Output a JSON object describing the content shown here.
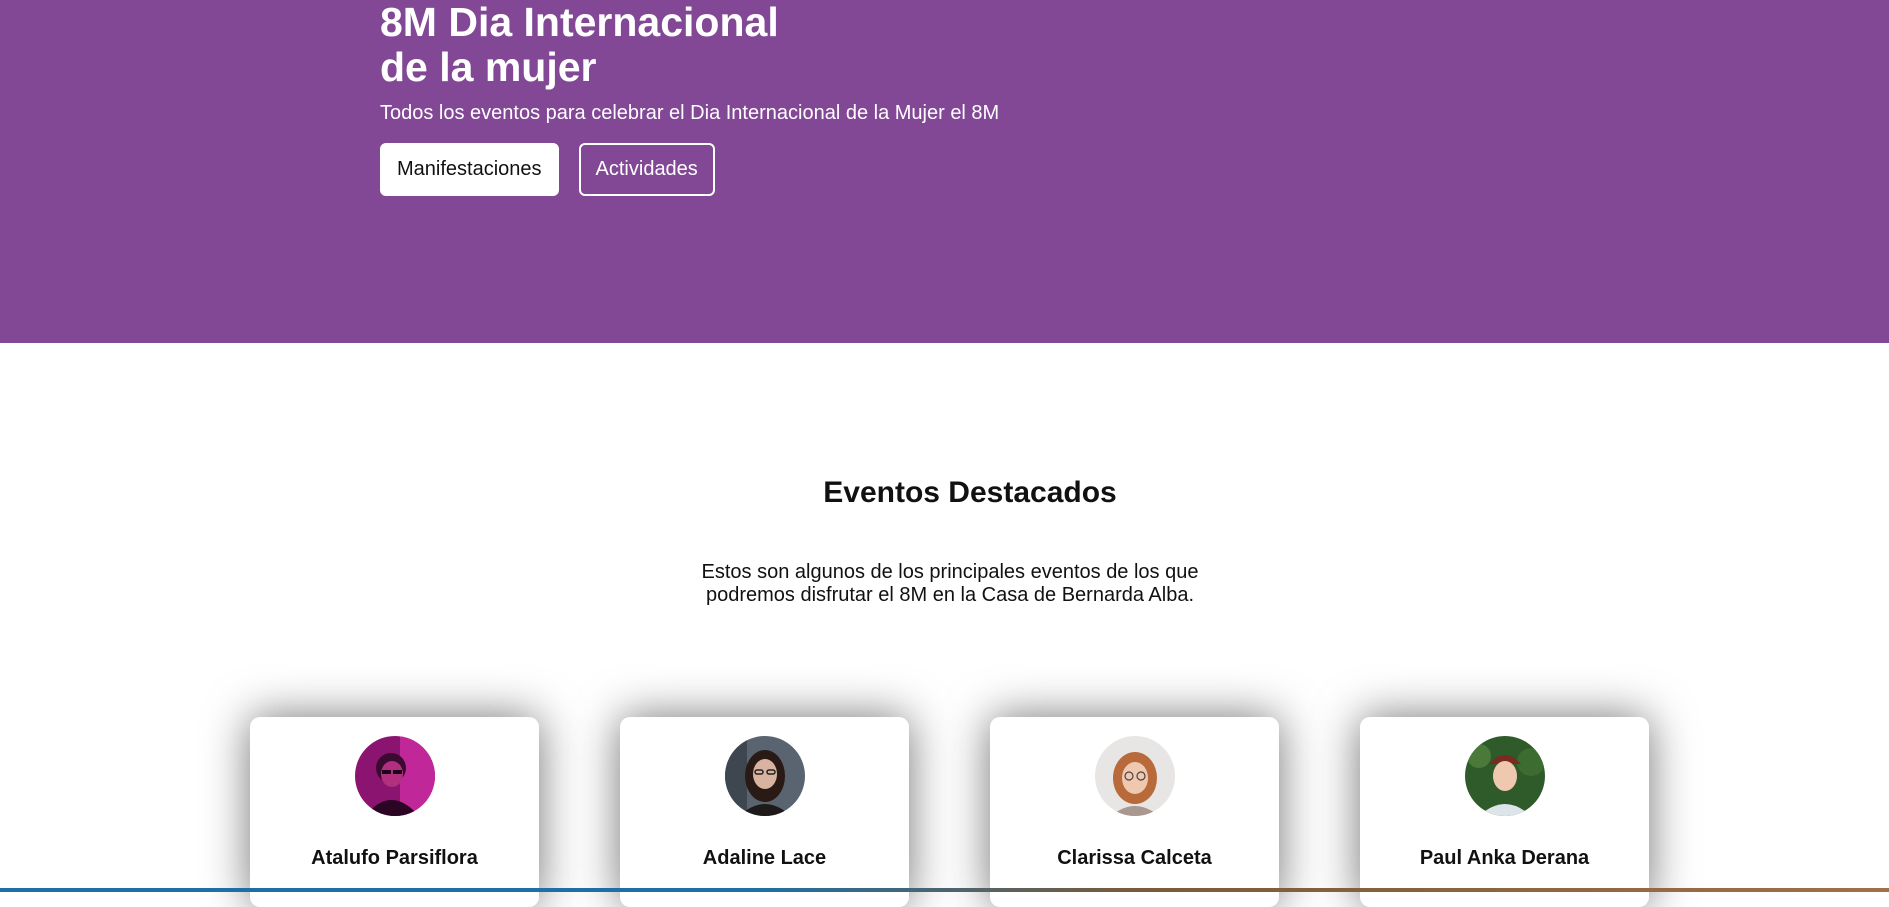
{
  "hero": {
    "title_line1": "8M Dia Internacional",
    "title_line2": "de la mujer",
    "subtitle": "Todos los eventos para celebrar el Dia Internacional de la Mujer el 8M",
    "buttons": [
      "Manifestaciones",
      "Actividades"
    ],
    "background_color": "#824896"
  },
  "featured": {
    "title": "Eventos Destacados",
    "description": "Estos son algunos de los principales eventos de los que podremos disfrutar el 8M en la Casa de Bernarda Alba."
  },
  "cards": [
    {
      "name": "Atalufo Parsiflora"
    },
    {
      "name": "Adaline Lace"
    },
    {
      "name": "Clarissa Calceta"
    },
    {
      "name": "Paul Anka Derana"
    }
  ]
}
